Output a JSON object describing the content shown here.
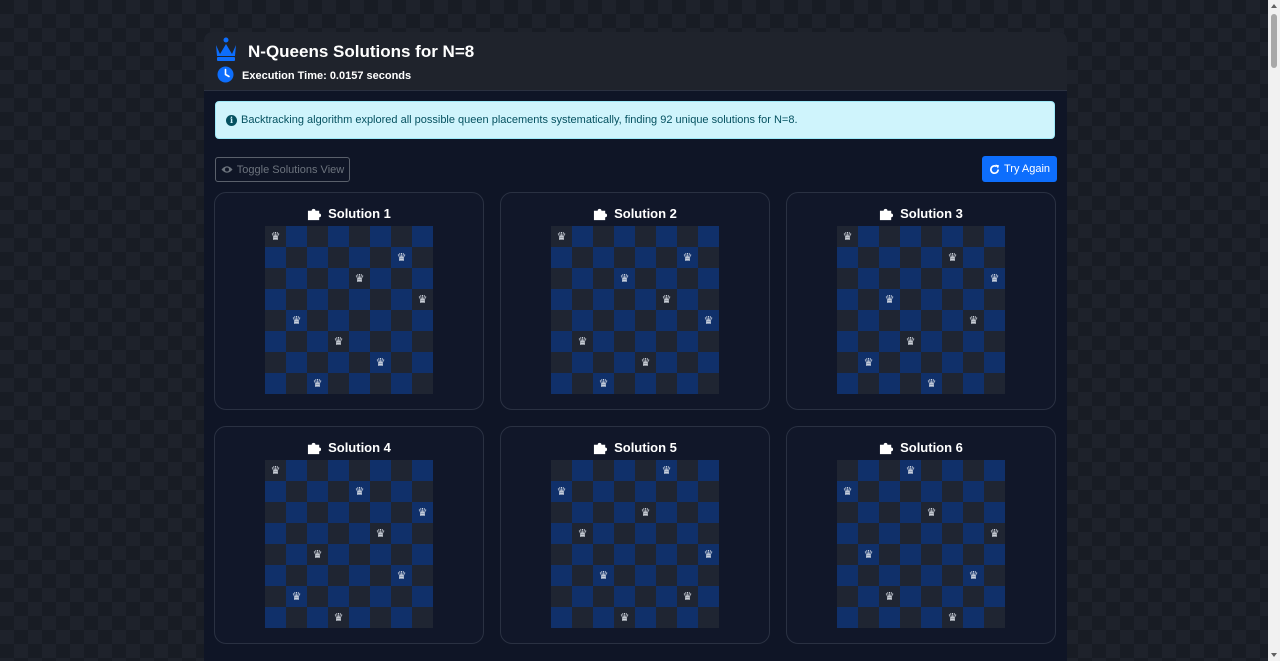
{
  "header": {
    "title": "N-Queens Solutions for N=8",
    "execution_time": "Execution Time: 0.0157 seconds"
  },
  "alert": {
    "message": "Backtracking algorithm explored all possible queen placements systematically, finding 92 unique solutions for N=8."
  },
  "toolbar": {
    "toggle_label": "Toggle Solutions View",
    "try_again_label": "Try Again"
  },
  "colors": {
    "accent": "#0d6efd",
    "board_light": "#1f2532",
    "board_dark": "#10306a",
    "alert_bg": "#cff4fc"
  },
  "icons": {
    "queen": "♛"
  },
  "solutions": [
    {
      "title": "Solution 1",
      "queens": [
        0,
        6,
        4,
        7,
        1,
        3,
        5,
        2
      ]
    },
    {
      "title": "Solution 2",
      "queens": [
        0,
        6,
        3,
        5,
        7,
        1,
        4,
        2
      ]
    },
    {
      "title": "Solution 3",
      "queens": [
        0,
        5,
        7,
        2,
        6,
        3,
        1,
        4
      ]
    },
    {
      "title": "Solution 4",
      "queens": [
        0,
        4,
        7,
        5,
        2,
        6,
        1,
        3
      ]
    },
    {
      "title": "Solution 5",
      "queens": [
        5,
        0,
        4,
        1,
        7,
        2,
        6,
        3
      ]
    },
    {
      "title": "Solution 6",
      "queens": [
        3,
        0,
        4,
        7,
        1,
        6,
        2,
        5
      ]
    }
  ]
}
